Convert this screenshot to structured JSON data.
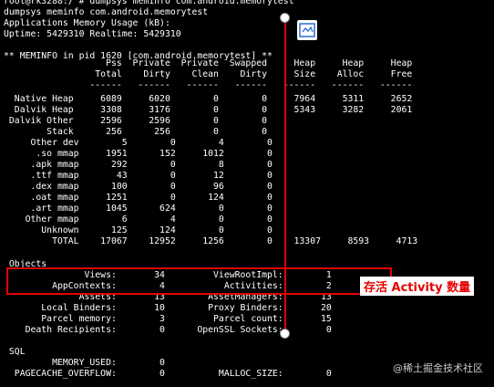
{
  "terminal": {
    "header": [
      "root@rk3288:/ # dumpsys meminfo com.android.memorytest",
      "dumpsys meminfo com.android.memorytest",
      "Applications Memory Usage (kB):",
      "Uptime: 5429310 Realtime: 5429310",
      "",
      "** MEMINFO in pid 1620 [com.android.memorytest] **"
    ],
    "table_header": [
      "                   Pss  Private  Private  Swapped     Heap     Heap     Heap",
      "                 Total    Dirty    Clean    Dirty     Size    Alloc     Free",
      "                ------   ------   ------   ------   ------   ------   ------"
    ],
    "rows": [
      "  Native Heap     6089     6020        0        0     7964     5311     2652",
      "  Dalvik Heap     3308     3176        0        0     5343     3282     2061",
      " Dalvik Other     2596     2596        0        0",
      "        Stack      256      256        0        0",
      "     Other dev        5        0        4        0",
      "      .so mmap     1951      152     1012        0",
      "     .apk mmap      292        0        8        0",
      "     .ttf mmap       43        0       12        0",
      "     .dex mmap      100        0       96        0",
      "     .oat mmap     1251        0      124        0",
      "     .art mmap     1045      624        0        0",
      "    Other mmap        6        4        0        0",
      "       Unknown      125      124        0        0",
      "         TOTAL    17067    12952     1256        0    13307     8593     4713"
    ],
    "objects": [
      "",
      " Objects",
      "               Views:       34         ViewRootImpl:        1",
      "         AppContexts:        4           Activities:        2",
      "              Assets:       13        AssetManagers:       13",
      "       Local Binders:       10        Proxy Binders:       20",
      "       Parcel memory:        3         Parcel count:       15",
      "    Death Recipients:        0      OpenSSL Sockets:        0",
      "",
      " SQL",
      "         MEMORY_USED:        0",
      "  PAGECACHE_OVERFLOW:        0          MALLOC_SIZE:        0"
    ]
  },
  "annotation": {
    "label": "存活 Activity 数量",
    "color": "#e60000"
  },
  "watermark": "@稀土掘金技术社区"
}
